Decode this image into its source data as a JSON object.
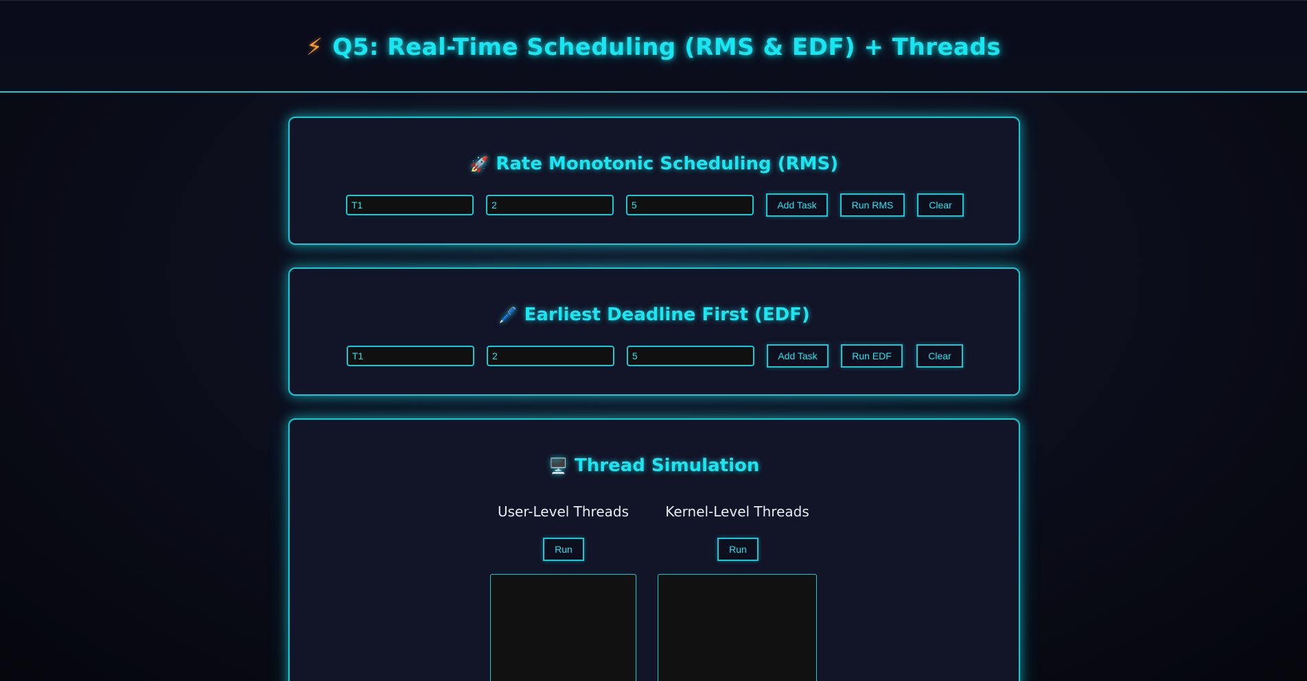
{
  "header": {
    "icon": "lightning-icon",
    "title": "Q5: Real-Time Scheduling (RMS & EDF) + Threads"
  },
  "rms": {
    "icon": "rocket-icon",
    "title": "Rate Monotonic Scheduling (RMS)",
    "task_name": "T1",
    "exec_time": "2",
    "period": "5",
    "add_label": "Add Task",
    "run_label": "Run RMS",
    "clear_label": "Clear"
  },
  "edf": {
    "icon": "pen-icon",
    "title": "Earliest Deadline First (EDF)",
    "task_name": "T1",
    "exec_time": "2",
    "deadline": "5",
    "add_label": "Add Task",
    "run_label": "Run EDF",
    "clear_label": "Clear"
  },
  "threads": {
    "icon": "computer-icon",
    "title": "Thread Simulation",
    "user": {
      "heading": "User-Level Threads",
      "run_label": "Run"
    },
    "kernel": {
      "heading": "Kernel-Level Threads",
      "run_label": "Run"
    }
  },
  "colors": {
    "accent": "#19e6f0",
    "highlight": "#f59a34",
    "card_bg": "#121427",
    "page_bg": "#0b0d1a"
  }
}
